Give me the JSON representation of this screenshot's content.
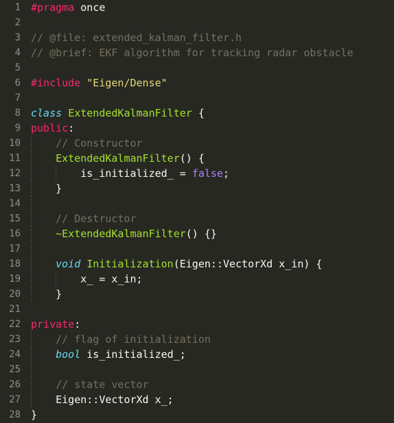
{
  "editor": {
    "theme_name": "Monokai",
    "language": "C++",
    "colors": {
      "background": "#272822",
      "line_number": "#8f908a",
      "default_text": "#f8f8f2",
      "comment": "#75715e",
      "keyword": "#f92672",
      "type": "#66d9ef",
      "entity": "#a6e22e",
      "string": "#e6db74",
      "constant": "#ae81ff",
      "indent_guide": "#4d4e47"
    },
    "first_line_number": 1,
    "last_line_number": 28,
    "total_lines": 28,
    "indent_guide_columns": [
      0,
      4
    ]
  },
  "lines": [
    {
      "number": "1",
      "guides": [],
      "tokens": [
        {
          "t": "#pragma",
          "c": "keyword"
        },
        {
          "t": " ",
          "c": "default"
        },
        {
          "t": "once",
          "c": "default"
        }
      ]
    },
    {
      "number": "2",
      "guides": [],
      "tokens": []
    },
    {
      "number": "3",
      "guides": [],
      "tokens": [
        {
          "t": "// @file: extended_kalman_filter.h",
          "c": "comment"
        }
      ]
    },
    {
      "number": "4",
      "guides": [],
      "tokens": [
        {
          "t": "// @brief: EKF algorithm for tracking radar obstacle",
          "c": "comment"
        }
      ]
    },
    {
      "number": "5",
      "guides": [],
      "tokens": []
    },
    {
      "number": "6",
      "guides": [],
      "tokens": [
        {
          "t": "#include",
          "c": "keyword"
        },
        {
          "t": " ",
          "c": "default"
        },
        {
          "t": "\"Eigen/Dense\"",
          "c": "string"
        }
      ]
    },
    {
      "number": "7",
      "guides": [],
      "tokens": []
    },
    {
      "number": "8",
      "guides": [],
      "tokens": [
        {
          "t": "class",
          "c": "type"
        },
        {
          "t": " ",
          "c": "default"
        },
        {
          "t": "ExtendedKalmanFilter",
          "c": "entity"
        },
        {
          "t": " ",
          "c": "default"
        },
        {
          "t": "{",
          "c": "punct"
        }
      ]
    },
    {
      "number": "9",
      "guides": [],
      "tokens": [
        {
          "t": "public",
          "c": "keyword"
        },
        {
          "t": ":",
          "c": "punct"
        }
      ]
    },
    {
      "number": "10",
      "guides": [
        0
      ],
      "tokens": [
        {
          "t": "    ",
          "c": "default"
        },
        {
          "t": "// Constructor",
          "c": "comment"
        }
      ]
    },
    {
      "number": "11",
      "guides": [
        0
      ],
      "tokens": [
        {
          "t": "    ",
          "c": "default"
        },
        {
          "t": "ExtendedKalmanFilter",
          "c": "entity"
        },
        {
          "t": "() {",
          "c": "punct"
        }
      ]
    },
    {
      "number": "12",
      "guides": [
        0,
        4
      ],
      "tokens": [
        {
          "t": "        ",
          "c": "default"
        },
        {
          "t": "is_initialized_",
          "c": "default"
        },
        {
          "t": " = ",
          "c": "operator"
        },
        {
          "t": "false",
          "c": "constant"
        },
        {
          "t": ";",
          "c": "punct"
        }
      ]
    },
    {
      "number": "13",
      "guides": [
        0
      ],
      "tokens": [
        {
          "t": "    ",
          "c": "default"
        },
        {
          "t": "}",
          "c": "punct"
        }
      ]
    },
    {
      "number": "14",
      "guides": [
        0
      ],
      "tokens": []
    },
    {
      "number": "15",
      "guides": [
        0
      ],
      "tokens": [
        {
          "t": "    ",
          "c": "default"
        },
        {
          "t": "// Destructor",
          "c": "comment"
        }
      ]
    },
    {
      "number": "16",
      "guides": [
        0
      ],
      "tokens": [
        {
          "t": "    ",
          "c": "default"
        },
        {
          "t": "~ExtendedKalmanFilter",
          "c": "entity"
        },
        {
          "t": "() {}",
          "c": "punct"
        }
      ]
    },
    {
      "number": "17",
      "guides": [
        0
      ],
      "tokens": []
    },
    {
      "number": "18",
      "guides": [
        0
      ],
      "tokens": [
        {
          "t": "    ",
          "c": "default"
        },
        {
          "t": "void",
          "c": "type"
        },
        {
          "t": " ",
          "c": "default"
        },
        {
          "t": "Initialization",
          "c": "entity"
        },
        {
          "t": "(Eigen::VectorXd x_in) {",
          "c": "default"
        }
      ]
    },
    {
      "number": "19",
      "guides": [
        0,
        4
      ],
      "tokens": [
        {
          "t": "        ",
          "c": "default"
        },
        {
          "t": "x_",
          "c": "default"
        },
        {
          "t": " = ",
          "c": "operator"
        },
        {
          "t": "x_in;",
          "c": "default"
        }
      ]
    },
    {
      "number": "20",
      "guides": [
        0
      ],
      "tokens": [
        {
          "t": "    ",
          "c": "default"
        },
        {
          "t": "}",
          "c": "punct"
        }
      ]
    },
    {
      "number": "21",
      "guides": [],
      "tokens": []
    },
    {
      "number": "22",
      "guides": [],
      "tokens": [
        {
          "t": "private",
          "c": "keyword"
        },
        {
          "t": ":",
          "c": "punct"
        }
      ]
    },
    {
      "number": "23",
      "guides": [
        0
      ],
      "tokens": [
        {
          "t": "    ",
          "c": "default"
        },
        {
          "t": "// flag of initialization",
          "c": "comment"
        }
      ]
    },
    {
      "number": "24",
      "guides": [
        0
      ],
      "tokens": [
        {
          "t": "    ",
          "c": "default"
        },
        {
          "t": "bool",
          "c": "type"
        },
        {
          "t": " ",
          "c": "default"
        },
        {
          "t": "is_initialized_;",
          "c": "default"
        }
      ]
    },
    {
      "number": "25",
      "guides": [
        0
      ],
      "tokens": []
    },
    {
      "number": "26",
      "guides": [
        0
      ],
      "tokens": [
        {
          "t": "    ",
          "c": "default"
        },
        {
          "t": "// state vector",
          "c": "comment"
        }
      ]
    },
    {
      "number": "27",
      "guides": [
        0
      ],
      "tokens": [
        {
          "t": "    ",
          "c": "default"
        },
        {
          "t": "Eigen::VectorXd x_;",
          "c": "default"
        }
      ]
    },
    {
      "number": "28",
      "guides": [],
      "tokens": [
        {
          "t": "}",
          "c": "punct"
        }
      ]
    }
  ]
}
